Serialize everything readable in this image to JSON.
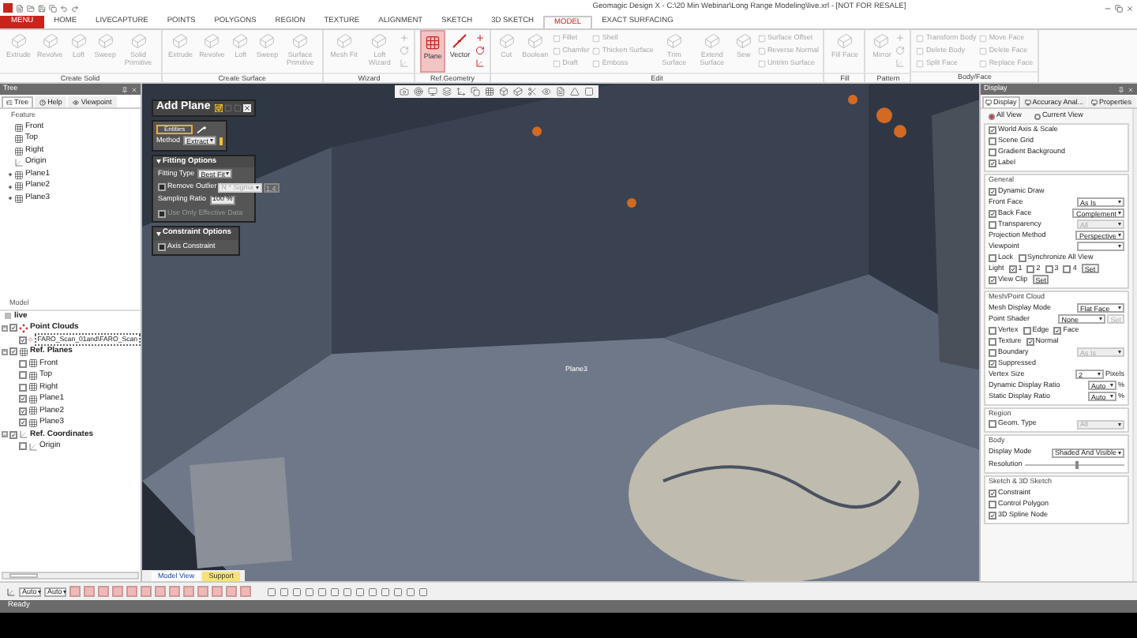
{
  "window": {
    "title": "Geomagic Design X - C:\\20 Min Webinar\\Long Range Modeling\\live.xrl - [NOT FOR RESALE]"
  },
  "menu_button": "MENU",
  "tabs": [
    {
      "label": "HOME",
      "selected": false
    },
    {
      "label": "LIVECAPTURE",
      "selected": false
    },
    {
      "label": "POINTS",
      "selected": false
    },
    {
      "label": "POLYGONS",
      "selected": false
    },
    {
      "label": "REGION",
      "selected": false
    },
    {
      "label": "TEXTURE",
      "selected": false
    },
    {
      "label": "ALIGNMENT",
      "selected": false
    },
    {
      "label": "SKETCH",
      "selected": false
    },
    {
      "label": "3D SKETCH",
      "selected": false
    },
    {
      "label": "MODEL",
      "selected": true
    },
    {
      "label": "EXACT SURFACING",
      "selected": false
    }
  ],
  "ribbon_groups": [
    {
      "title": "Create Solid",
      "items": [
        {
          "kind": "large",
          "label": "Extrude",
          "disabled": true,
          "selected": false
        },
        {
          "kind": "large",
          "label": "Revolve",
          "disabled": true,
          "selected": false
        },
        {
          "kind": "large",
          "label": "Loft",
          "disabled": true,
          "selected": false
        },
        {
          "kind": "large",
          "label": "Sweep",
          "disabled": true,
          "selected": false
        },
        {
          "kind": "large",
          "label": "Solid Primitive",
          "disabled": true,
          "selected": false
        }
      ]
    },
    {
      "title": "Create Surface",
      "items": [
        {
          "kind": "large",
          "label": "Extrude",
          "disabled": true,
          "selected": false
        },
        {
          "kind": "large",
          "label": "Revolve",
          "disabled": true,
          "selected": false
        },
        {
          "kind": "large",
          "label": "Loft",
          "disabled": true,
          "selected": false
        },
        {
          "kind": "large",
          "label": "Sweep",
          "disabled": true,
          "selected": false
        },
        {
          "kind": "large",
          "label": "Surface Primitive",
          "disabled": true,
          "selected": false
        }
      ]
    },
    {
      "title": "Wizard",
      "items": [
        {
          "kind": "large",
          "label": "Mesh Fit",
          "disabled": true,
          "selected": false
        },
        {
          "kind": "large",
          "label": "Loft Wizard",
          "disabled": true,
          "selected": false
        },
        {
          "kind": "icons",
          "disabled": true
        }
      ]
    },
    {
      "title": "Ref.Geometry",
      "items": [
        {
          "kind": "large",
          "label": "Plane",
          "disabled": false,
          "selected": true
        },
        {
          "kind": "large",
          "label": "Vector",
          "disabled": false,
          "selected": false
        },
        {
          "kind": "icons",
          "disabled": false
        }
      ]
    },
    {
      "title": "Edit",
      "items": [
        {
          "kind": "large",
          "label": "Cut",
          "disabled": true,
          "selected": false
        },
        {
          "kind": "large",
          "label": "Boolean",
          "disabled": true,
          "selected": false
        },
        {
          "kind": "column",
          "labels": [
            "Fillet",
            "Chamfer",
            "Draft"
          ],
          "disabled": true
        },
        {
          "kind": "column",
          "labels": [
            "Shell",
            "Thicken Surface",
            "Emboss"
          ],
          "disabled": true
        },
        {
          "kind": "large",
          "label": "Trim Surface",
          "disabled": true,
          "selected": false
        },
        {
          "kind": "large",
          "label": "Extend Surface",
          "disabled": true,
          "selected": false
        },
        {
          "kind": "large",
          "label": "Sew",
          "disabled": true,
          "selected": false
        },
        {
          "kind": "column",
          "labels": [
            "Surface Offset",
            "Reverse Normal",
            "Untrim Surface"
          ],
          "disabled": true
        }
      ]
    },
    {
      "title": "Fill",
      "items": [
        {
          "kind": "large",
          "label": "Fill Face",
          "disabled": true,
          "selected": false
        }
      ]
    },
    {
      "title": "Pattern",
      "items": [
        {
          "kind": "large",
          "label": "Mirror",
          "disabled": true,
          "selected": false
        },
        {
          "kind": "icons",
          "disabled": true
        }
      ]
    },
    {
      "title": "Body/Face",
      "items": [
        {
          "kind": "column",
          "labels": [
            "Transform Body",
            "Delete Body",
            "Split Face"
          ],
          "disabled": true
        },
        {
          "kind": "column",
          "labels": [
            "Move Face",
            "Delete Face",
            "Replace Face"
          ],
          "disabled": true
        }
      ]
    }
  ],
  "tree_panel": {
    "title": "Tree",
    "tabs": [
      {
        "label": "Tree",
        "selected": true
      },
      {
        "label": "Help",
        "selected": false
      },
      {
        "label": "Viewpoint",
        "selected": false
      }
    ],
    "feature_heading": "Feature",
    "features": [
      {
        "label": "Front",
        "kind": "plane",
        "expandable": false
      },
      {
        "label": "Top",
        "kind": "plane",
        "expandable": false
      },
      {
        "label": "Right",
        "kind": "plane",
        "expandable": false
      },
      {
        "label": "Origin",
        "kind": "origin",
        "expandable": false
      },
      {
        "label": "Plane1",
        "kind": "plane",
        "expandable": true
      },
      {
        "label": "Plane2",
        "kind": "plane",
        "expandable": true
      },
      {
        "label": "Plane3",
        "kind": "plane",
        "expandable": true
      }
    ],
    "model_heading": "Model",
    "model_root": "live",
    "model": [
      {
        "label": "Point Clouds",
        "kind": "cloud",
        "checked": true,
        "expanded": true,
        "children": [
          {
            "label": "FARO_Scan_01and\\FARO_Scan",
            "kind": "cloud",
            "checked": true,
            "selected": true
          }
        ]
      },
      {
        "label": "Ref. Planes",
        "kind": "plane",
        "checked": true,
        "expanded": true,
        "children": [
          {
            "label": "Front",
            "kind": "plane",
            "checked": false,
            "selected": false
          },
          {
            "label": "Top",
            "kind": "plane",
            "checked": false,
            "selected": false
          },
          {
            "label": "Right",
            "kind": "plane",
            "checked": false,
            "selected": false
          },
          {
            "label": "Plane1",
            "kind": "plane",
            "checked": true,
            "selected": false
          },
          {
            "label": "Plane2",
            "kind": "plane",
            "checked": true,
            "selected": false
          },
          {
            "label": "Plane3",
            "kind": "plane",
            "checked": true,
            "selected": false
          }
        ]
      },
      {
        "label": "Ref. Coordinates",
        "kind": "origin",
        "checked": true,
        "expanded": true,
        "children": [
          {
            "label": "Origin",
            "kind": "origin",
            "checked": false,
            "selected": false
          }
        ]
      }
    ]
  },
  "add_plane": {
    "title": "Add Plane",
    "entities": "Entities",
    "method_label": "Method",
    "method": "Extract",
    "fitting": {
      "title": "Fitting Options",
      "type_label": "Fitting Type",
      "type": "Best Fit",
      "outlier_label": "Remove Outlier",
      "outlier_checked": false,
      "outlier_mode": "N * Sigma",
      "outlier_value": "1.4",
      "sampling_label": "Sampling Ratio",
      "sampling": "100 %",
      "effective_label": "Use Only Effective Data",
      "effective_checked": false,
      "effective_disabled": true
    },
    "constraint": {
      "title": "Constraint Options",
      "axis_label": "Axis Constraint",
      "axis_checked": false
    }
  },
  "viewport": {
    "plane_label": "Plane3",
    "view_tabs": [
      {
        "label": "Model View",
        "selected": true
      },
      {
        "label": "Support",
        "selected": false
      }
    ]
  },
  "display_panel": {
    "title": "Display",
    "tabs": [
      {
        "label": "Display",
        "selected": true
      },
      {
        "label": "Accuracy Anal...",
        "selected": false
      },
      {
        "label": "Properties",
        "selected": false
      }
    ],
    "view_options": [
      {
        "label": "All View",
        "selected": true
      },
      {
        "label": "Current View",
        "selected": false
      }
    ],
    "groups": [
      {
        "rows": [
          {
            "kind": "check",
            "label": "World Axis & Scale",
            "checked": true
          },
          {
            "kind": "check",
            "label": "Scene Grid",
            "checked": false
          },
          {
            "kind": "check",
            "label": "Gradient Background",
            "checked": false
          },
          {
            "kind": "check",
            "label": "Label",
            "checked": true
          }
        ]
      },
      {
        "title": "General",
        "rows": [
          {
            "kind": "check",
            "label": "Dynamic Draw",
            "checked": true
          },
          {
            "kind": "select",
            "label": "Front Face",
            "value": "As Is",
            "disabled": false
          },
          {
            "kind": "check_select",
            "label": "Back Face",
            "checked": true,
            "value": "Complement",
            "disabled": false
          },
          {
            "kind": "check_select",
            "label": "Transparency",
            "checked": false,
            "value": "All",
            "disabled": true
          },
          {
            "kind": "select",
            "label": "Projection Method",
            "value": "Perspective",
            "disabled": false
          },
          {
            "kind": "select",
            "label": "Viewpoint",
            "disabled": false
          },
          {
            "kind": "checks",
            "items": [
              {
                "label": "Lock",
                "checked": false
              },
              {
                "label": "Synchronize All View",
                "checked": false
              }
            ]
          },
          {
            "kind": "checks",
            "label": "Light",
            "items": [
              {
                "label": "1",
                "checked": true
              },
              {
                "label": "2",
                "checked": false
              },
              {
                "label": "3",
                "checked": false
              },
              {
                "label": "4",
                "checked": false
              }
            ],
            "button": "Set"
          },
          {
            "kind": "checks",
            "items": [
              {
                "label": "View Clip",
                "checked": true
              }
            ],
            "button": "Set"
          }
        ]
      },
      {
        "title": "Mesh/Point Cloud",
        "rows": [
          {
            "kind": "select",
            "label": "Mesh Display Mode",
            "value": "Flat Face",
            "disabled": false
          },
          {
            "kind": "select",
            "label": "Point Shader",
            "value": "None",
            "disabled": false,
            "button": "Set"
          },
          {
            "kind": "checks",
            "items": [
              {
                "label": "Vertex",
                "checked": false
              },
              {
                "label": "Edge",
                "checked": false
              },
              {
                "label": "Face",
                "checked": true
              }
            ]
          },
          {
            "kind": "checks",
            "items": [
              {
                "label": "Texture",
                "checked": false
              },
              {
                "label": "Normal",
                "checked": true
              }
            ]
          },
          {
            "kind": "check_select",
            "label": "Boundary",
            "checked": false,
            "value": "As Is",
            "disabled": true
          },
          {
            "kind": "check",
            "label": "Suppressed",
            "checked": true
          },
          {
            "kind": "select",
            "label": "Vertex Size",
            "value": "2",
            "disabled": false,
            "unit": "Pixels"
          },
          {
            "kind": "select",
            "label": "Dynamic Display Ratio",
            "value": "Auto",
            "disabled": false,
            "unit": "%"
          },
          {
            "kind": "select",
            "label": "Static Display Ratio",
            "value": "Auto",
            "disabled": false,
            "unit": "%"
          }
        ]
      },
      {
        "title": "Region",
        "rows": [
          {
            "kind": "check_select",
            "label": "Geom. Type",
            "checked": false,
            "value": "All",
            "disabled": true
          }
        ]
      },
      {
        "title": "Body",
        "rows": [
          {
            "kind": "select",
            "label": "Display Mode",
            "value": "Shaded And Visible",
            "disabled": false
          },
          {
            "kind": "slider",
            "label": "Resolution",
            "level": 0.5
          }
        ]
      },
      {
        "title": "Sketch & 3D Sketch",
        "rows": [
          {
            "kind": "check",
            "label": "Constraint",
            "checked": true
          },
          {
            "kind": "check",
            "label": "Control Polygon",
            "checked": false
          },
          {
            "kind": "check",
            "label": "3D Spline Node",
            "checked": true
          }
        ]
      }
    ]
  },
  "bottom_toolbar": {
    "combos": [
      "Auto",
      "Auto"
    ]
  },
  "status_bar": {
    "text": "Ready"
  }
}
